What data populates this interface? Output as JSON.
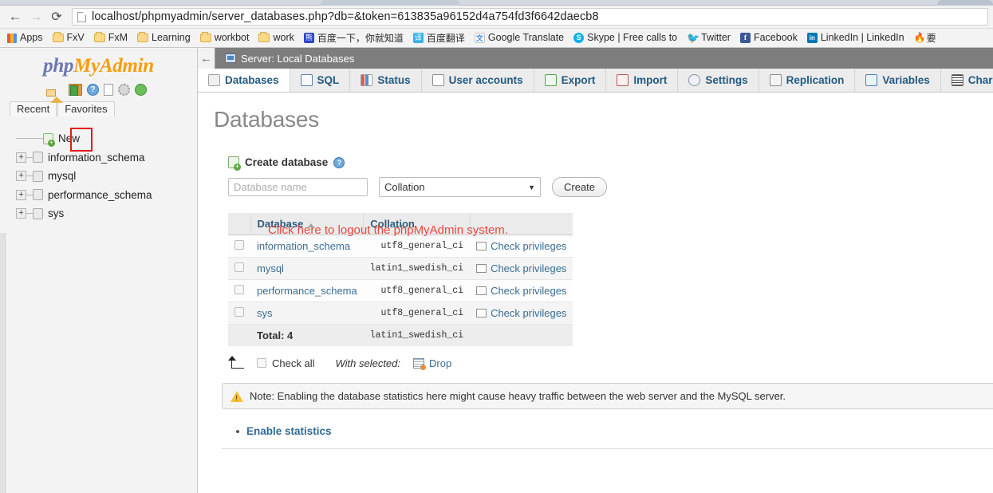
{
  "browser": {
    "back_icon": "←",
    "forward_icon": "→",
    "reload_icon": "⟳",
    "url": "localhost/phpmyadmin/server_databases.php?db=&token=613835a96152d4a754fd3f6642daecb8",
    "bookmarks": [
      {
        "label": "Apps",
        "icon": "apps-grid-icon"
      },
      {
        "label": "FxV",
        "icon": "folder-icon"
      },
      {
        "label": "FxM",
        "icon": "folder-icon"
      },
      {
        "label": "Learning",
        "icon": "folder-icon"
      },
      {
        "label": "workbot",
        "icon": "folder-icon"
      },
      {
        "label": "work",
        "icon": "folder-icon"
      },
      {
        "label": "百度一下，你就知道",
        "icon": "baidu-icon"
      },
      {
        "label": "百度翻译",
        "icon": "baidu-fanyi-icon"
      },
      {
        "label": "Google Translate",
        "icon": "google-translate-icon"
      },
      {
        "label": "Skype | Free calls to",
        "icon": "skype-icon"
      },
      {
        "label": "Twitter",
        "icon": "twitter-icon"
      },
      {
        "label": "Facebook",
        "icon": "facebook-icon"
      },
      {
        "label": "LinkedIn | LinkedIn",
        "icon": "linkedin-icon"
      },
      {
        "label": "",
        "icon": "flame-icon"
      }
    ]
  },
  "sidebar": {
    "logo": {
      "php": "php",
      "my": "My",
      "admin": "Admin"
    },
    "nav_icons": [
      {
        "name": "home-icon",
        "title": "Home"
      },
      {
        "name": "logout-icon",
        "title": "Log out"
      },
      {
        "name": "help-icon",
        "title": "phpMyAdmin documentation",
        "glyph": "?"
      },
      {
        "name": "documentation-icon",
        "title": "Documentation"
      },
      {
        "name": "settings-gear-icon",
        "title": "Navigation settings"
      },
      {
        "name": "globe-icon",
        "title": "Server"
      }
    ],
    "recent_label": "Recent",
    "favorites_label": "Favorites",
    "tree": [
      {
        "label": "New",
        "expandable": false,
        "icon": "new-database-icon"
      },
      {
        "label": "information_schema",
        "expandable": true,
        "expander": "+",
        "icon": "database-icon"
      },
      {
        "label": "mysql",
        "expandable": true,
        "expander": "+",
        "icon": "database-icon"
      },
      {
        "label": "performance_schema",
        "expandable": true,
        "expander": "+",
        "icon": "database-icon"
      },
      {
        "label": "sys",
        "expandable": true,
        "expander": "+",
        "icon": "database-icon"
      }
    ]
  },
  "annotation": {
    "text": "Click here to logout the phpMyAdmin system.",
    "color": "#e8473c",
    "highlight_box_color": "#e21b1b"
  },
  "server_bar": {
    "back_icon": "←",
    "title": "Server: Local Databases",
    "icon": "server-monitor-icon"
  },
  "tabs": [
    {
      "label": "Databases",
      "icon": "databases-icon",
      "active": true
    },
    {
      "label": "SQL",
      "icon": "sql-icon",
      "active": false
    },
    {
      "label": "Status",
      "icon": "status-icon",
      "active": false
    },
    {
      "label": "User accounts",
      "icon": "user-accounts-icon",
      "active": false
    },
    {
      "label": "Export",
      "icon": "export-icon",
      "active": false
    },
    {
      "label": "Import",
      "icon": "import-icon",
      "active": false
    },
    {
      "label": "Settings",
      "icon": "settings-icon",
      "active": false
    },
    {
      "label": "Replication",
      "icon": "replication-icon",
      "active": false
    },
    {
      "label": "Variables",
      "icon": "variables-icon",
      "active": false
    },
    {
      "label": "Charsets",
      "icon": "charsets-icon",
      "active": false
    }
  ],
  "main": {
    "page_title": "Databases",
    "create": {
      "heading": "Create database",
      "help_glyph": "?",
      "name_placeholder": "Database name",
      "name_value": "",
      "collation_selected": "Collation",
      "collation_caret": "▼",
      "create_button": "Create"
    },
    "table": {
      "headers": {
        "checkbox": "",
        "database": "Database",
        "collation": "Collation",
        "actions": ""
      },
      "sort": "ascending",
      "rows": [
        {
          "name": "information_schema",
          "collation": "utf8_general_ci",
          "action": "Check privileges"
        },
        {
          "name": "mysql",
          "collation": "latin1_swedish_ci",
          "action": "Check privileges"
        },
        {
          "name": "performance_schema",
          "collation": "utf8_general_ci",
          "action": "Check privileges"
        },
        {
          "name": "sys",
          "collation": "utf8_general_ci",
          "action": "Check privileges"
        }
      ],
      "total_label": "Total: 4",
      "total_collation": "latin1_swedish_ci"
    },
    "actions": {
      "check_all": "Check all",
      "with_selected": "With selected:",
      "drop": "Drop"
    },
    "note": "Note: Enabling the database statistics here might cause heavy traffic between the web server and the MySQL server.",
    "enable_statistics": "Enable statistics"
  }
}
